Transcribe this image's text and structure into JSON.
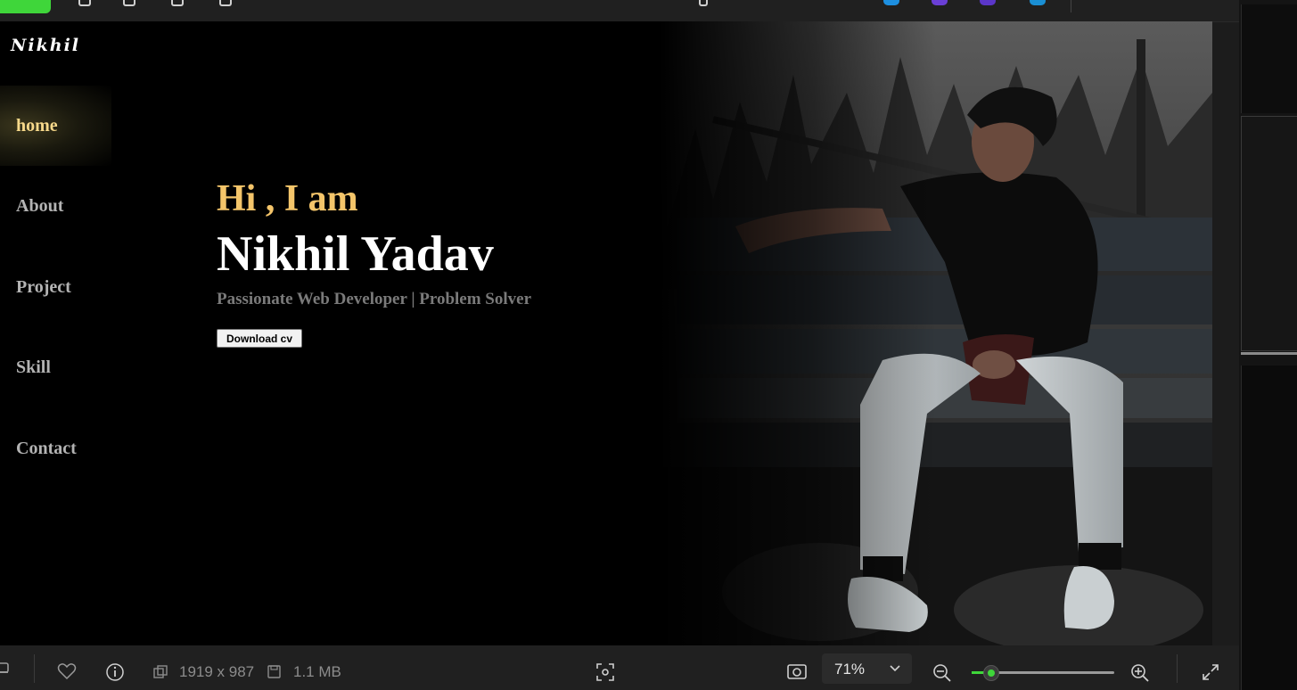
{
  "site": {
    "logo": "Nikhil",
    "nav": [
      {
        "label": "home",
        "active": true
      },
      {
        "label": "About",
        "active": false
      },
      {
        "label": "Project",
        "active": false
      },
      {
        "label": "Skill",
        "active": false
      },
      {
        "label": "Contact",
        "active": false
      }
    ],
    "hero": {
      "greeting": "Hi , I am",
      "name": "Nikhil Yadav",
      "tagline": "Passionate Web Developer | Problem Solver",
      "cv_button": "Download cv"
    },
    "colors": {
      "accent": "#f4c56a",
      "nav_active": "#f7d98b",
      "background": "#000000"
    }
  },
  "viewer": {
    "dimensions": "1919 x 987",
    "file_size": "1.1 MB",
    "zoom": "71%",
    "zoom_level": 0.14,
    "icons": [
      "film-strip-icon",
      "heart-icon",
      "info-icon",
      "resize-icon",
      "save-icon",
      "focus-icon",
      "screenshot-icon",
      "chevron-down-icon",
      "zoom-out-icon",
      "zoom-in-icon",
      "expand-icon"
    ],
    "accent": "#3fd63a"
  }
}
